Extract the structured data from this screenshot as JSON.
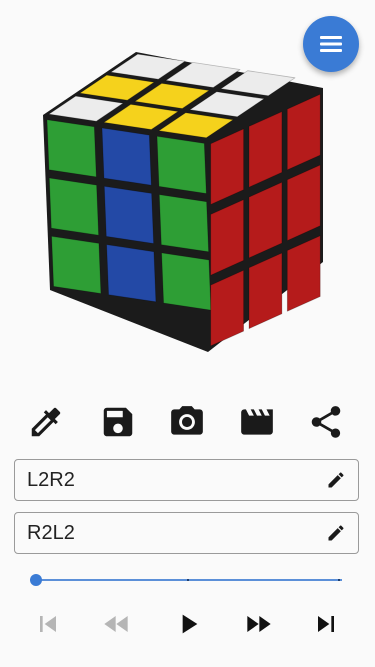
{
  "fields": {
    "algorithm_1": "L2R2",
    "algorithm_2": "R2L2"
  },
  "slider": {
    "position": 0
  },
  "colors": {
    "accent": "#3a7bd5",
    "white": "#ececec",
    "yellow": "#f5d21c",
    "green": "#2e9e35",
    "blue": "#2349a6",
    "red": "#b51b1b"
  },
  "icons": {
    "menu": "hamburger-icon",
    "toolbar": [
      "eyedropper-icon",
      "save-icon",
      "camera-icon",
      "clapperboard-icon",
      "share-icon"
    ],
    "edit": "pencil-icon",
    "playback": [
      "skip-to-start-icon",
      "rewind-icon",
      "play-icon",
      "fast-forward-icon",
      "skip-to-end-icon"
    ]
  }
}
